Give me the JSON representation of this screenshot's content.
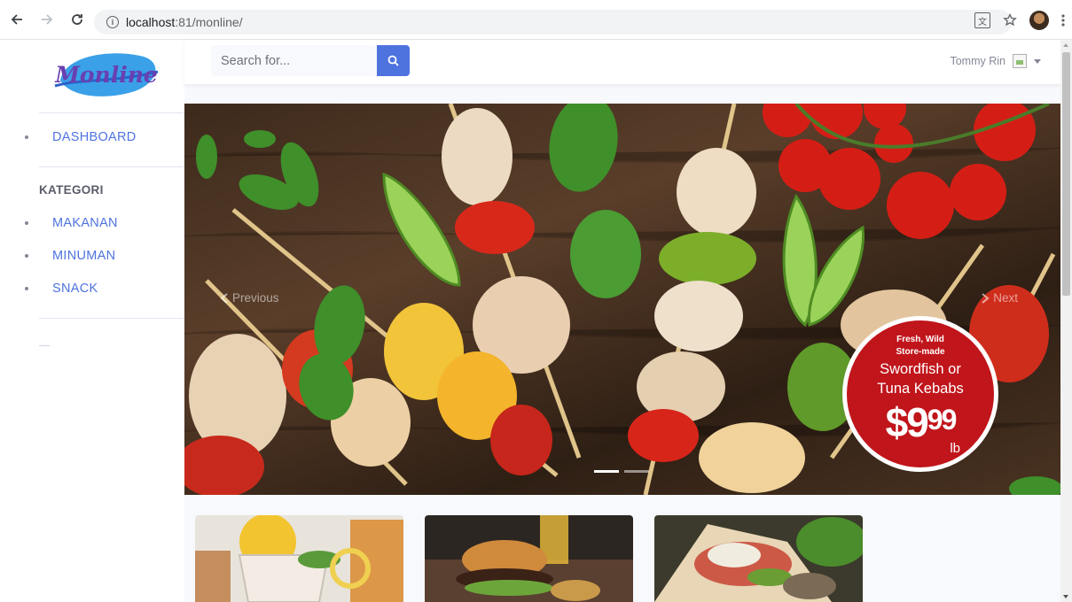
{
  "browser": {
    "url_host": "localhost",
    "url_path": ":81/monline/",
    "back_icon": "arrow-left-icon",
    "forward_icon": "arrow-right-icon",
    "reload_icon": "reload-icon"
  },
  "brand": {
    "logo_text": "Monline"
  },
  "sidebar": {
    "items": [
      {
        "label": "DASHBOARD"
      }
    ],
    "category_heading": "KATEGORI",
    "categories": [
      {
        "label": "MAKANAN"
      },
      {
        "label": "MINUMAN"
      },
      {
        "label": "SNACK"
      }
    ]
  },
  "topbar": {
    "search_placeholder": "Search for...",
    "user_name": "Tommy Rin"
  },
  "carousel": {
    "prev_label": "Previous",
    "next_label": "Next",
    "slide_count": 2,
    "active_slide": 1,
    "badge": {
      "line1": "Fresh, Wild",
      "line2": "Store-made",
      "line3": "Swordfish or",
      "line4": "Tuna Kebabs",
      "price": "$9",
      "cents": "99",
      "unit": "lb"
    }
  },
  "colors": {
    "primary": "#4e73df",
    "badge_red": "#c0151b"
  }
}
